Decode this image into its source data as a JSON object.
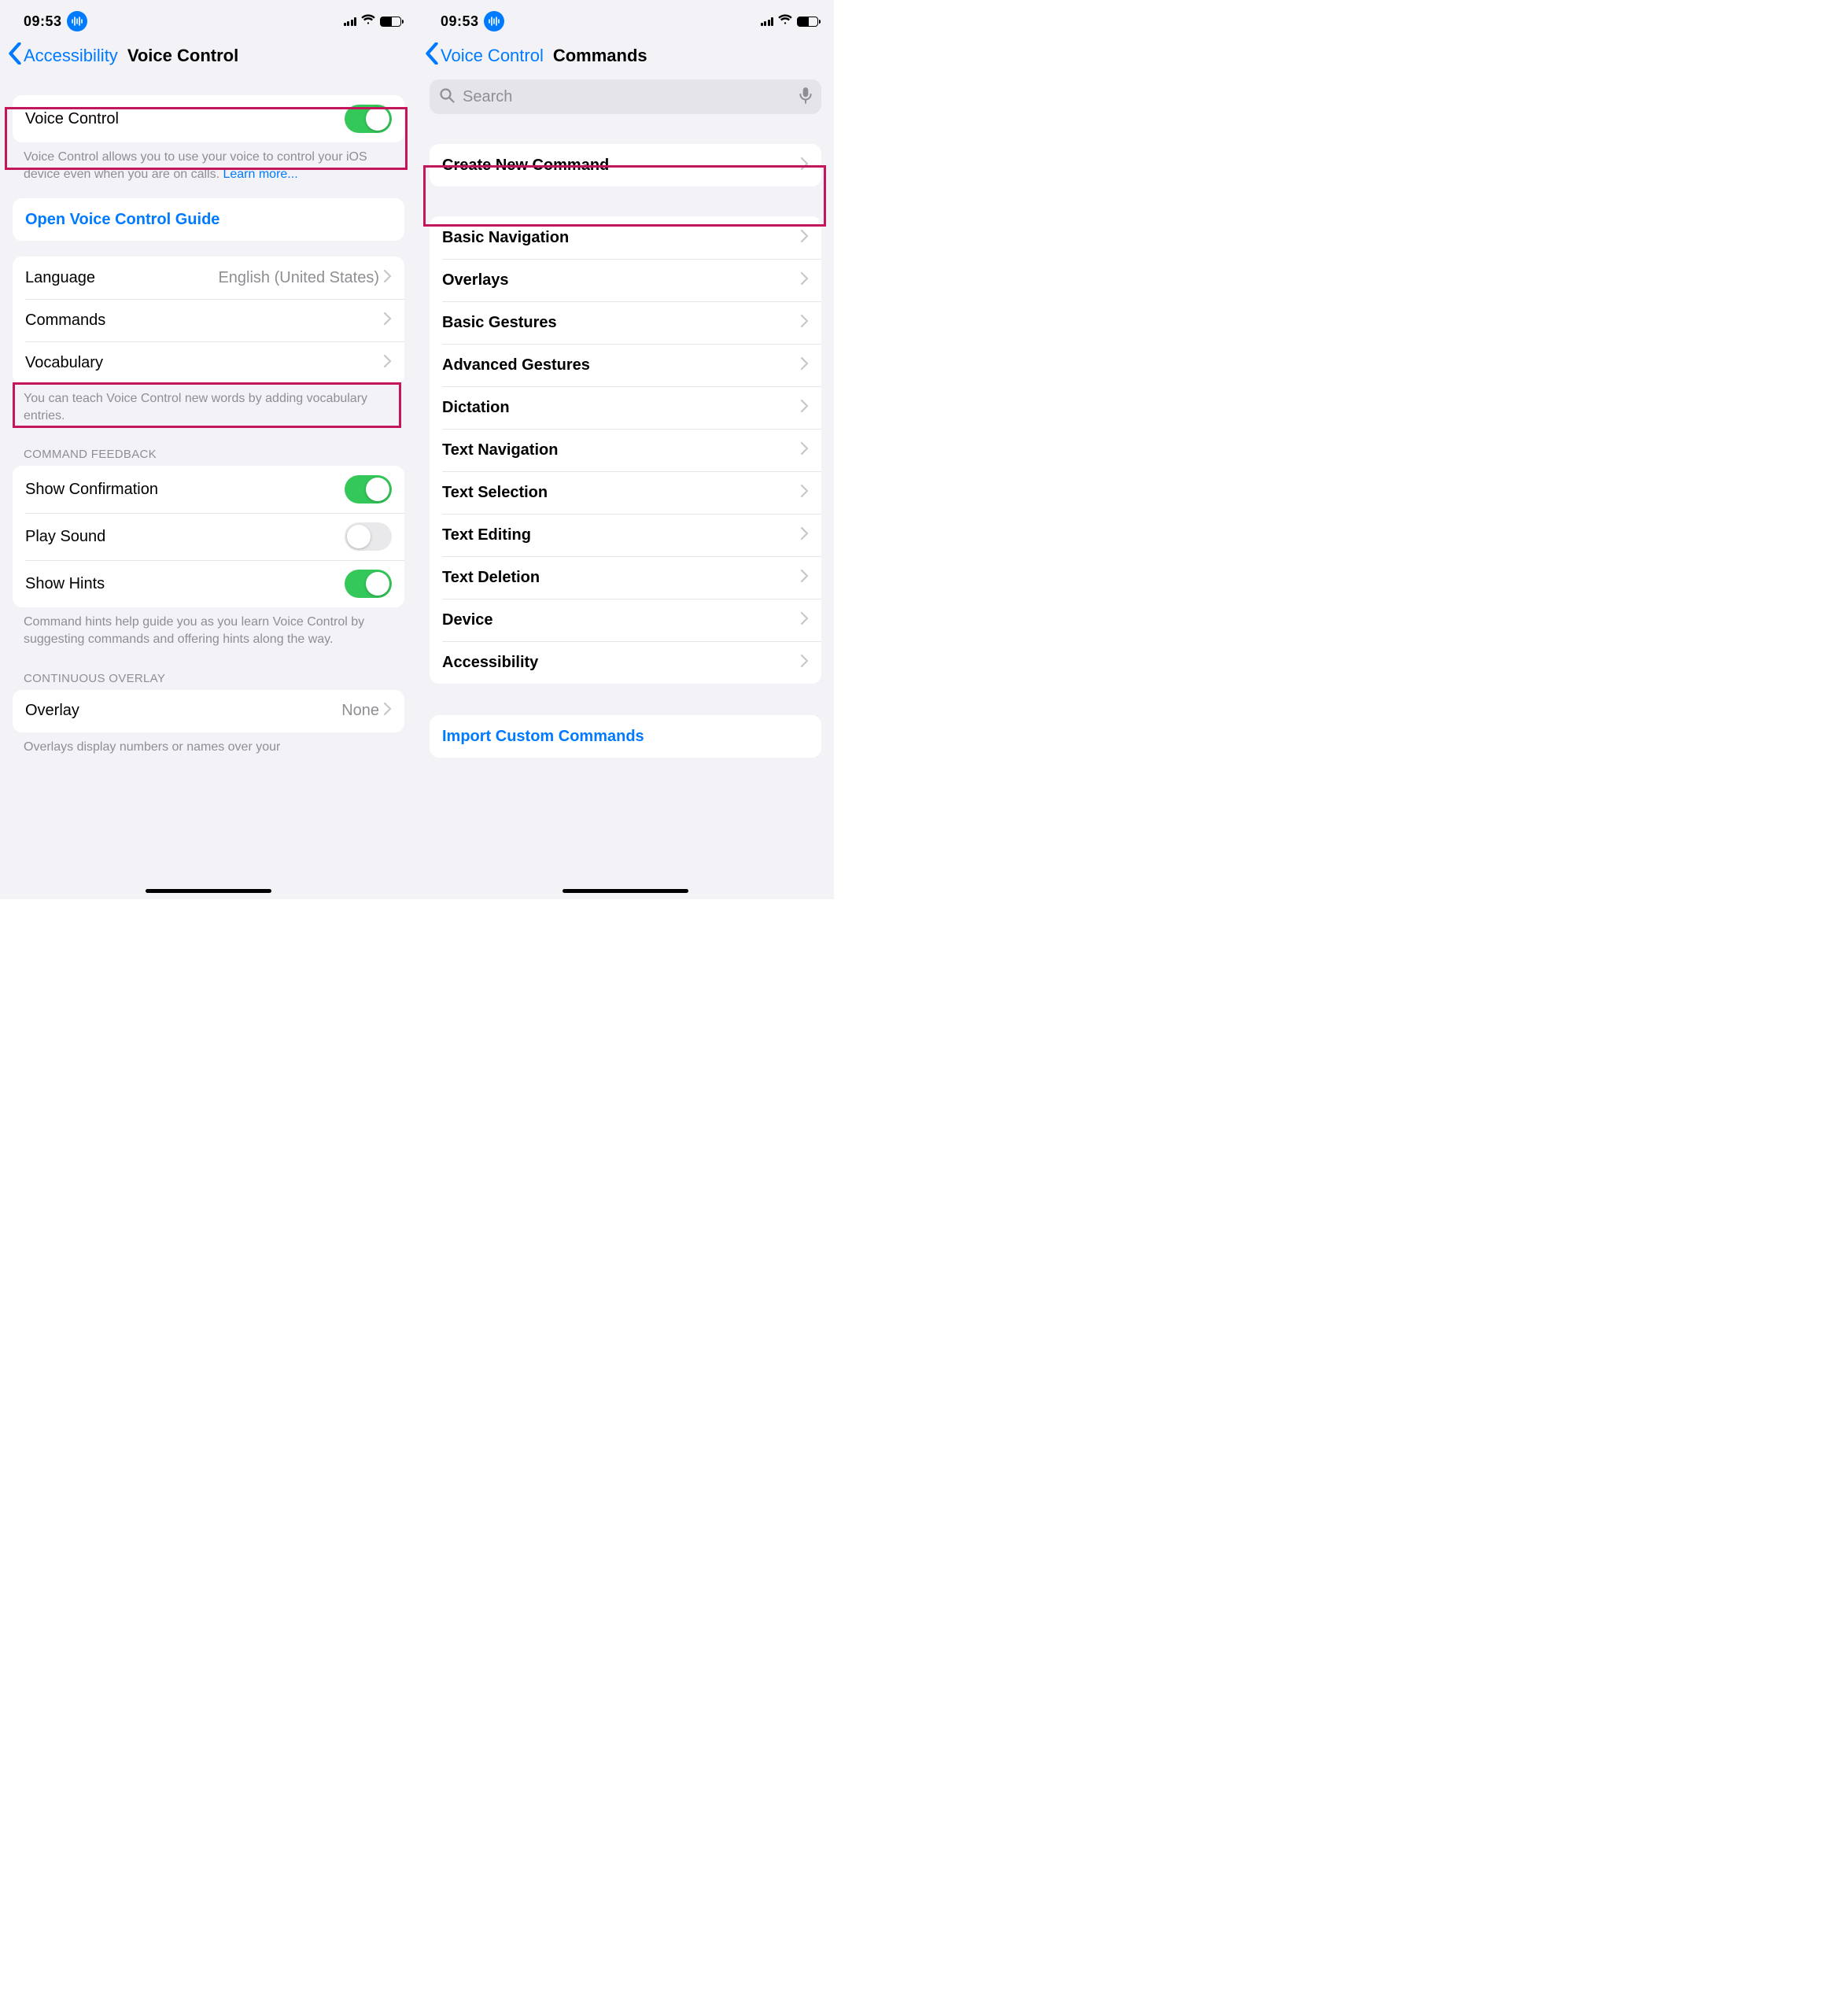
{
  "status": {
    "time": "09:53"
  },
  "left": {
    "nav": {
      "back": "Accessibility",
      "title": "Voice Control"
    },
    "g1": {
      "voice_control": {
        "label": "Voice Control",
        "on": true
      },
      "footer": "Voice Control allows you to use your voice to control your iOS device even when you are on calls. ",
      "learn_more": "Learn more..."
    },
    "g2": {
      "guide": "Open Voice Control Guide"
    },
    "g3": {
      "language": {
        "label": "Language",
        "value": "English (United States)"
      },
      "commands": {
        "label": "Commands"
      },
      "vocabulary": {
        "label": "Vocabulary"
      },
      "footer": "You can teach Voice Control new words by adding vocabulary entries."
    },
    "g4": {
      "header": "Command Feedback",
      "confirm": {
        "label": "Show Confirmation",
        "on": true
      },
      "sound": {
        "label": "Play Sound",
        "on": false
      },
      "hints": {
        "label": "Show Hints",
        "on": true
      },
      "footer": "Command hints help guide you as you learn Voice Control by suggesting commands and offering hints along the way."
    },
    "g5": {
      "header": "Continuous Overlay",
      "overlay": {
        "label": "Overlay",
        "value": "None"
      },
      "footer": "Overlays display numbers or names over your"
    }
  },
  "right": {
    "nav": {
      "back": "Voice Control",
      "title": "Commands"
    },
    "search": {
      "placeholder": "Search"
    },
    "create": "Create New Command",
    "categories": [
      "Basic Navigation",
      "Overlays",
      "Basic Gestures",
      "Advanced Gestures",
      "Dictation",
      "Text Navigation",
      "Text Selection",
      "Text Editing",
      "Text Deletion",
      "Device",
      "Accessibility"
    ],
    "import": "Import Custom Commands"
  }
}
